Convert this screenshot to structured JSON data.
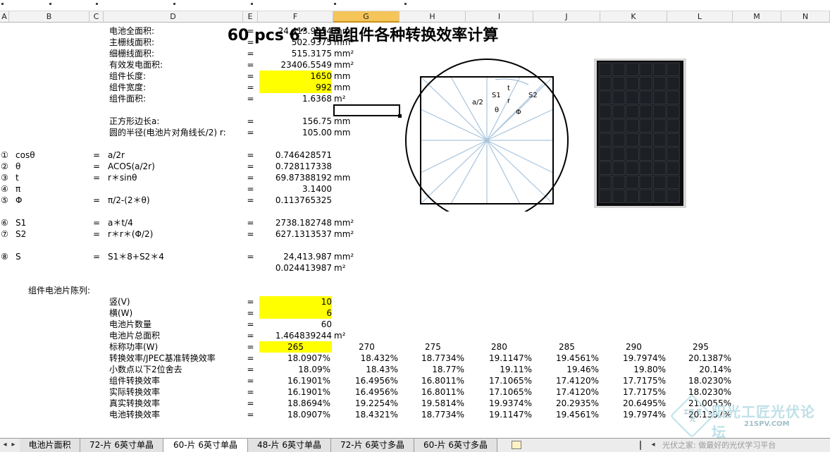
{
  "columns": [
    "A",
    "B",
    "C",
    "D",
    "E",
    "F",
    "G",
    "H",
    "I",
    "J",
    "K",
    "L",
    "M",
    "N"
  ],
  "selected_column": "G",
  "title": "60 pcs 6″ 单晶组件各种转换效率计算",
  "area": {
    "rows": [
      {
        "label": "电池全面积:",
        "eq": "=",
        "value": "24,413.9874",
        "unit": "mm²"
      },
      {
        "label": "主栅线面积:",
        "eq": "=",
        "value": "502.9375",
        "unit": "mm²"
      },
      {
        "label": "细栅线面积:",
        "eq": "=",
        "value": "515.3175",
        "unit": "mm²"
      },
      {
        "label": "有效发电面积:",
        "eq": "=",
        "value": "23406.5549",
        "unit": "mm²"
      },
      {
        "label": "组件长度:",
        "eq": "=",
        "value": "1650",
        "unit": "mm"
      },
      {
        "label": "组件宽度:",
        "eq": "=",
        "value": "992",
        "unit": "mm"
      },
      {
        "label": "组件面积:",
        "eq": "=",
        "value": "1.6368",
        "unit": "m²"
      }
    ],
    "square_label": "正方形边长a:",
    "square_value": "156.75",
    "square_unit": "mm",
    "radius_label": "圆的半径(电池片对角线长/2) r:",
    "radius_value": "105.00",
    "radius_unit": "mm"
  },
  "formulas": [
    {
      "num": "①",
      "sym": "cosθ",
      "eq1": "=",
      "expr": "a/2r",
      "eq2": "=",
      "value": "0.746428571",
      "unit": ""
    },
    {
      "num": "②",
      "sym": "θ",
      "eq1": "=",
      "expr": "ACOS(a/2r)",
      "eq2": "=",
      "value": "0.728117338",
      "unit": ""
    },
    {
      "num": "③",
      "sym": "t",
      "eq1": "=",
      "expr": "r＊sinθ",
      "eq2": "=",
      "value": "69.87388192",
      "unit": "mm"
    },
    {
      "num": "④",
      "sym": "π",
      "eq1": "",
      "expr": "",
      "eq2": "=",
      "value": "3.1400",
      "unit": ""
    },
    {
      "num": "⑤",
      "sym": "Φ",
      "eq1": "=",
      "expr": "π/2-(2＊θ)",
      "eq2": "=",
      "value": "0.113765325",
      "unit": ""
    },
    {
      "num": "⑥",
      "sym": "S1",
      "eq1": "=",
      "expr": "a＊t/4",
      "eq2": "=",
      "value": "2738.182748",
      "unit": "mm²"
    },
    {
      "num": "⑦",
      "sym": "S2",
      "eq1": "=",
      "expr": "r＊r＊(Φ/2)",
      "eq2": "=",
      "value": "627.1313537",
      "unit": "mm²"
    },
    {
      "num": "⑧",
      "sym": "S",
      "eq1": "=",
      "expr": "S1＊8+S2＊4",
      "eq2": "=",
      "value": "24,413.987",
      "unit": "mm²"
    }
  ],
  "s_value_m2": "0.024413987",
  "s_unit_m2": "m²",
  "diagram_labels": {
    "t": "t",
    "s1": "S1",
    "s2": "S2",
    "a2": "a/2",
    "r": "r",
    "theta": "θ",
    "phi": "Φ"
  },
  "array_section": {
    "heading": "组件电池片陈列:",
    "rows": [
      {
        "label": "竖(V)",
        "eq": "=",
        "value": "10",
        "unit": ""
      },
      {
        "label": "横(W)",
        "eq": "=",
        "value": "6",
        "unit": ""
      },
      {
        "label": "电池片数量",
        "eq": "=",
        "value": "60",
        "unit": ""
      },
      {
        "label": "电池片总面积",
        "eq": "=",
        "value": "1.464839244",
        "unit": "m²"
      }
    ]
  },
  "power_table": {
    "power_label": "标称功率(W)",
    "powers": [
      "265",
      "270",
      "275",
      "280",
      "285",
      "290",
      "295"
    ],
    "rows": [
      {
        "label": "转换效率/JPEC基准转换效率",
        "values": [
          "18.0907%",
          "18.432%",
          "18.7734%",
          "19.1147%",
          "19.4561%",
          "19.7974%",
          "20.1387%"
        ]
      },
      {
        "label": "小数点以下2位舍去",
        "values": [
          "18.09%",
          "18.43%",
          "18.77%",
          "19.11%",
          "19.46%",
          "19.80%",
          "20.14%"
        ]
      },
      {
        "label": "组件转换效率",
        "values": [
          "16.1901%",
          "16.4956%",
          "16.8011%",
          "17.1065%",
          "17.4120%",
          "17.7175%",
          "18.0230%"
        ]
      },
      {
        "label": "实际转换效率",
        "values": [
          "16.1901%",
          "16.4956%",
          "16.8011%",
          "17.1065%",
          "17.4120%",
          "17.7175%",
          "18.0230%"
        ]
      },
      {
        "label": "真实转换效率",
        "values": [
          "18.8694%",
          "19.2254%",
          "19.5814%",
          "19.9374%",
          "20.2935%",
          "20.6495%",
          "21.0055%"
        ]
      },
      {
        "label": "电池转换效率",
        "values": [
          "18.0907%",
          "18.4321%",
          "18.7734%",
          "19.1147%",
          "19.4561%",
          "19.7974%",
          "20.1387%"
        ]
      }
    ]
  },
  "tabs": [
    "电池片面积",
    "72-片 6英寸单晶",
    "60-片 6英寸单晶",
    "48-片 6英寸单晶",
    "72-片 6英寸多晶",
    "60-片 6英寸多晶"
  ],
  "active_tab": "60-片 6英寸单晶",
  "watermark": {
    "badge": "工匠 匠光",
    "brand": "阳光工匠光伏论坛",
    "url": "21SPV.COM",
    "slogan": "光伏之家: 做最好的光伏学习平台"
  },
  "colors": {
    "highlight": "#ffff00",
    "selected_header": "#f5c55a",
    "diagram_lines": "#a9c4dc",
    "panel": "#1a1a1a"
  }
}
